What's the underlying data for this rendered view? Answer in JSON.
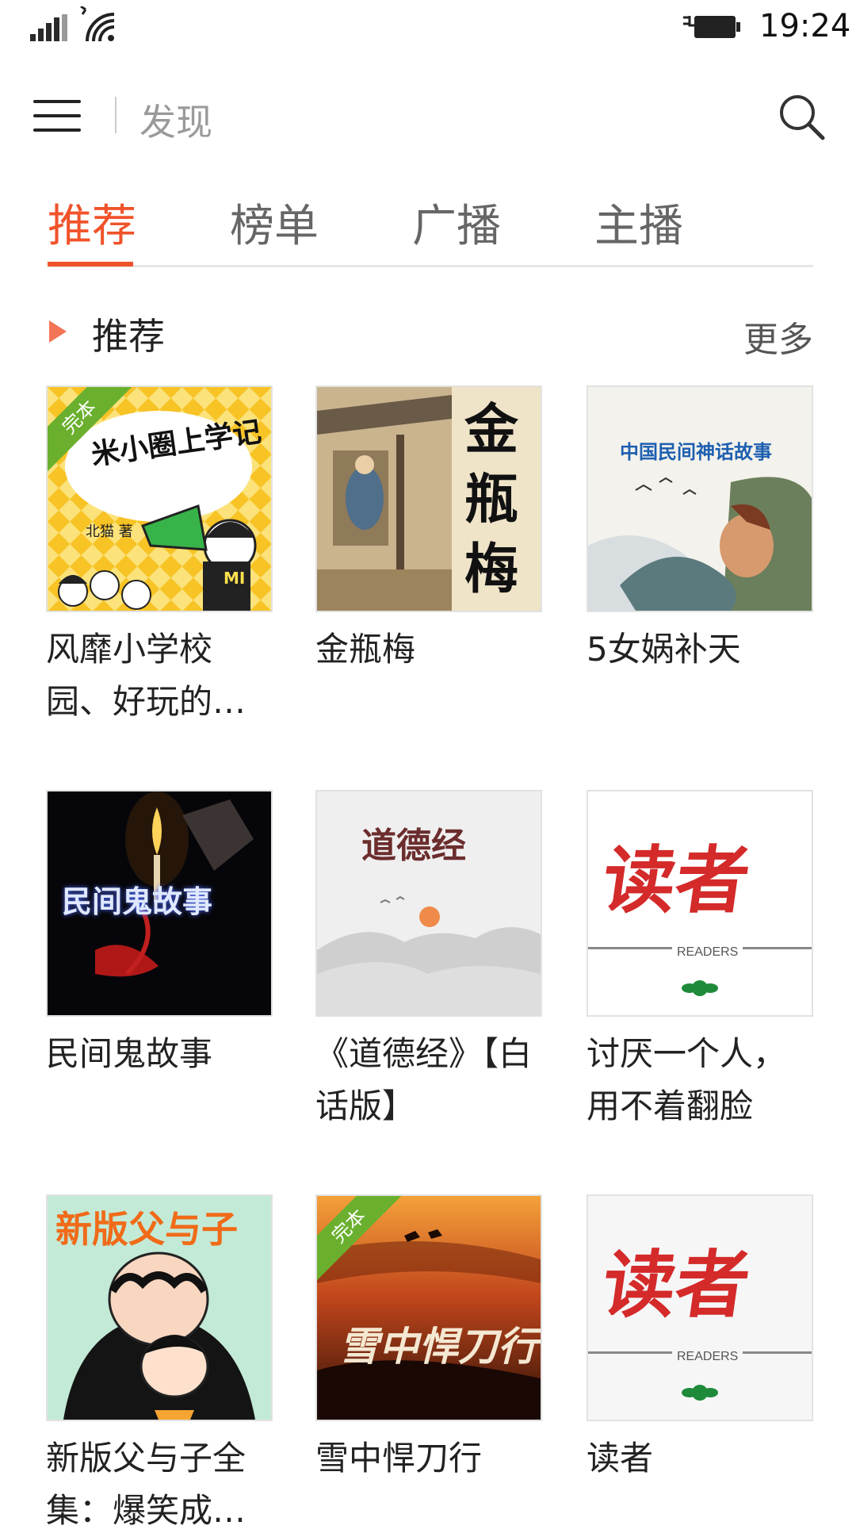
{
  "status_bar": {
    "time": "19:24"
  },
  "header": {
    "title": "发现"
  },
  "tabs": [
    {
      "label": "推荐",
      "active": true
    },
    {
      "label": "榜单",
      "active": false
    },
    {
      "label": "广播",
      "active": false
    },
    {
      "label": "主播",
      "active": false
    }
  ],
  "section": {
    "title": "推荐",
    "more": "更多"
  },
  "cards": [
    {
      "title": "风靡小学校园、好玩的…",
      "badge": "完本",
      "cover_text": "米小圈上学记",
      "cover_sub": "北猫 著"
    },
    {
      "title": "金瓶梅",
      "cover_text": "金瓶梅"
    },
    {
      "title": "5女娲补天",
      "cover_text": "中国民间神话故事"
    },
    {
      "title": "民间鬼故事",
      "cover_text": "民间鬼故事"
    },
    {
      "title": "《道德经》【白话版】",
      "cover_text": "道德经"
    },
    {
      "title": "讨厌一个人，用不着翻脸",
      "cover_text": "读者",
      "cover_sub": "READERS"
    },
    {
      "title": "新版父与子全集：爆笑成…",
      "cover_text": "新版父与子"
    },
    {
      "title": "雪中悍刀行",
      "badge": "完本",
      "cover_text": "雪中悍刀行"
    },
    {
      "title": "读者",
      "cover_text": "读者",
      "cover_sub": "READERS"
    }
  ],
  "colors": {
    "accent": "#f0532b",
    "badge": "#6ab02e"
  }
}
